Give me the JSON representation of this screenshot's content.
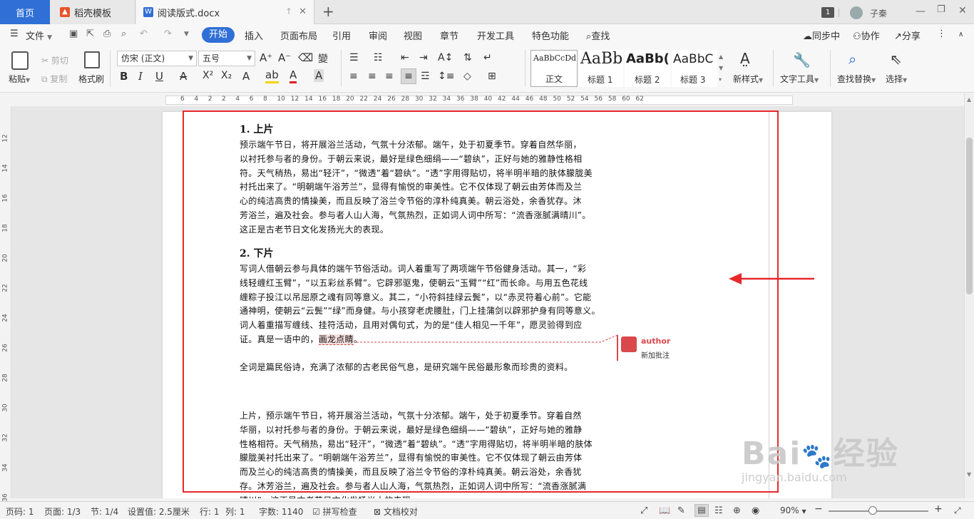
{
  "tabs": {
    "home": "首页",
    "daoke": "稻壳模板",
    "doc": "阅读版式.docx",
    "new_tab_icon": "plus-icon"
  },
  "window": {
    "badge": "1",
    "user": "子秦"
  },
  "menu": {
    "file": "文件",
    "items": [
      "开始",
      "插入",
      "页面布局",
      "引用",
      "审阅",
      "视图",
      "章节",
      "开发工具",
      "特色功能"
    ],
    "search": "查找",
    "sync": "同步中",
    "collab": "协作",
    "share": "分享"
  },
  "ribbon": {
    "paste": "粘贴",
    "cut": "剪切",
    "copy": "复制",
    "format_painter": "格式刷",
    "font_name": "仿宋 (正文)",
    "font_size": "五号",
    "styles": [
      {
        "sample": "AaBbCcDd",
        "label": "正文"
      },
      {
        "sample": "AaBb",
        "label": "标题 1"
      },
      {
        "sample": "AaBb(",
        "label": "标题 2"
      },
      {
        "sample": "AaBbC",
        "label": "标题 3"
      }
    ],
    "new_style": "新样式",
    "text_tools": "文字工具",
    "find_replace": "查找替换",
    "select": "选择"
  },
  "ruler": {
    "h_ticks": [
      "6",
      "4",
      "2",
      "2",
      "4",
      "6",
      "8",
      "10",
      "12",
      "14",
      "16",
      "18",
      "20",
      "22",
      "24",
      "26",
      "28",
      "30",
      "32",
      "34",
      "36",
      "38",
      "40",
      "42",
      "44",
      "46",
      "48",
      "50",
      "52",
      "54",
      "56",
      "58",
      "60",
      "62"
    ],
    "v_ticks": [
      "12",
      "14",
      "16",
      "18",
      "20",
      "22",
      "24",
      "26",
      "28",
      "30",
      "32",
      "34",
      "36"
    ]
  },
  "document": {
    "h1": "1.  上片",
    "p1": [
      "预示端午节日，将开展浴兰活动，气氛十分浓郁。端午，处于初夏季节。穿着自然华丽，",
      "以衬托参与者的身份。于朝云来说，最好是绿色细绢——“碧纨”，正好与她的雅静性格相",
      "符。天气稍热，易出“轻汗”，“微透”着“碧纨”。“透”字用得贴切，将半明半暗的肤体朦胧美",
      "衬托出来了。“明朝端午浴芳兰”，显得有愉悦的审美性。它不仅体现了朝云由芳体而及兰",
      "心的纯洁高贵的情操美，而且反映了浴兰令节俗的淳朴纯真美。朝云浴处，余香犹存。沐",
      "芳浴兰，遍及社会。参与者人山人海，气氛热烈，正如词人词中所写：“流香涨腻满晴川”。",
      "这正是古老节日文化发扬光大的表现。"
    ],
    "h2": "2.  下片",
    "p2": [
      "写词人借朝云参与具体的端午节俗活动。词人着重写了两项端午节俗健身活动。其一，“彩",
      "线轻缠红玉臂”，“以五彩丝系臂”。它辟邪驱鬼，使朝云“玉臂”“红”而长命。与用五色花线",
      "缠粽子投江以吊屈原之魂有同等意义。其二，“小符斜挂绿云鬓”，以“赤灵符着心前”。它能",
      "通神明，使朝云“云鬓”“绿”而身健。与小孩穿老虎腰肚，门上挂蒲剑以辟邪护身有同等意义。",
      "词人着重描写缠线、挂符活动，且用对偶句式，为的是“佳人相见一千年”，愿灵验得到应"
    ],
    "p2_last_prefix": "证。真是一语中的，",
    "p2_highlight": "画龙点睛",
    "p2_last_suffix": "。",
    "p3": "全词是篇民俗诗，充满了浓郁的古老民俗气息，是研究端午民俗最形象而珍贵的资料。",
    "p4": [
      "上片，预示端午节日，将开展浴兰活动，气氛十分浓郁。端午，处于初夏季节。穿着自然",
      "华丽，以衬托参与者的身份。于朝云来说，最好是绿色细绢——“碧纨”，正好与她的雅静",
      "性格相符。天气稍热，易出“轻汗”，“微透”着“碧纨”。“透”字用得贴切，将半明半暗的肤体",
      "朦胧美衬托出来了。“明朝端午浴芳兰”，显得有愉悦的审美性。它不仅体现了朝云由芳体",
      "而及兰心的纯洁高贵的情操美，而且反映了浴兰令节俗的淳朴纯真美。朝云浴处，余香犹",
      "存。沐芳浴兰，遍及社会。参与者人山人海，气氛热烈，正如词人词中所写：“流香涨腻满",
      "晴川”。这正是古老节日文化发扬光大的表现。"
    ]
  },
  "comment": {
    "author": "author",
    "text": "新加批注"
  },
  "status": {
    "page_no": "页码: 1",
    "page_of": "页面: 1/3",
    "section": "节: 1/4",
    "setting": "设置值: 2.5厘米",
    "line": "行: 1",
    "col": "列: 1",
    "words": "字数: 1140",
    "spell": "拼写检查",
    "proof": "文档校对",
    "zoom": "90%"
  },
  "watermark": {
    "brand": "Bai",
    "brand2": "经验",
    "url": "jingyan.baidu.com"
  },
  "colors": {
    "accent": "#2f6fd6",
    "frame": "#e8282b",
    "comment": "#d9484b"
  }
}
